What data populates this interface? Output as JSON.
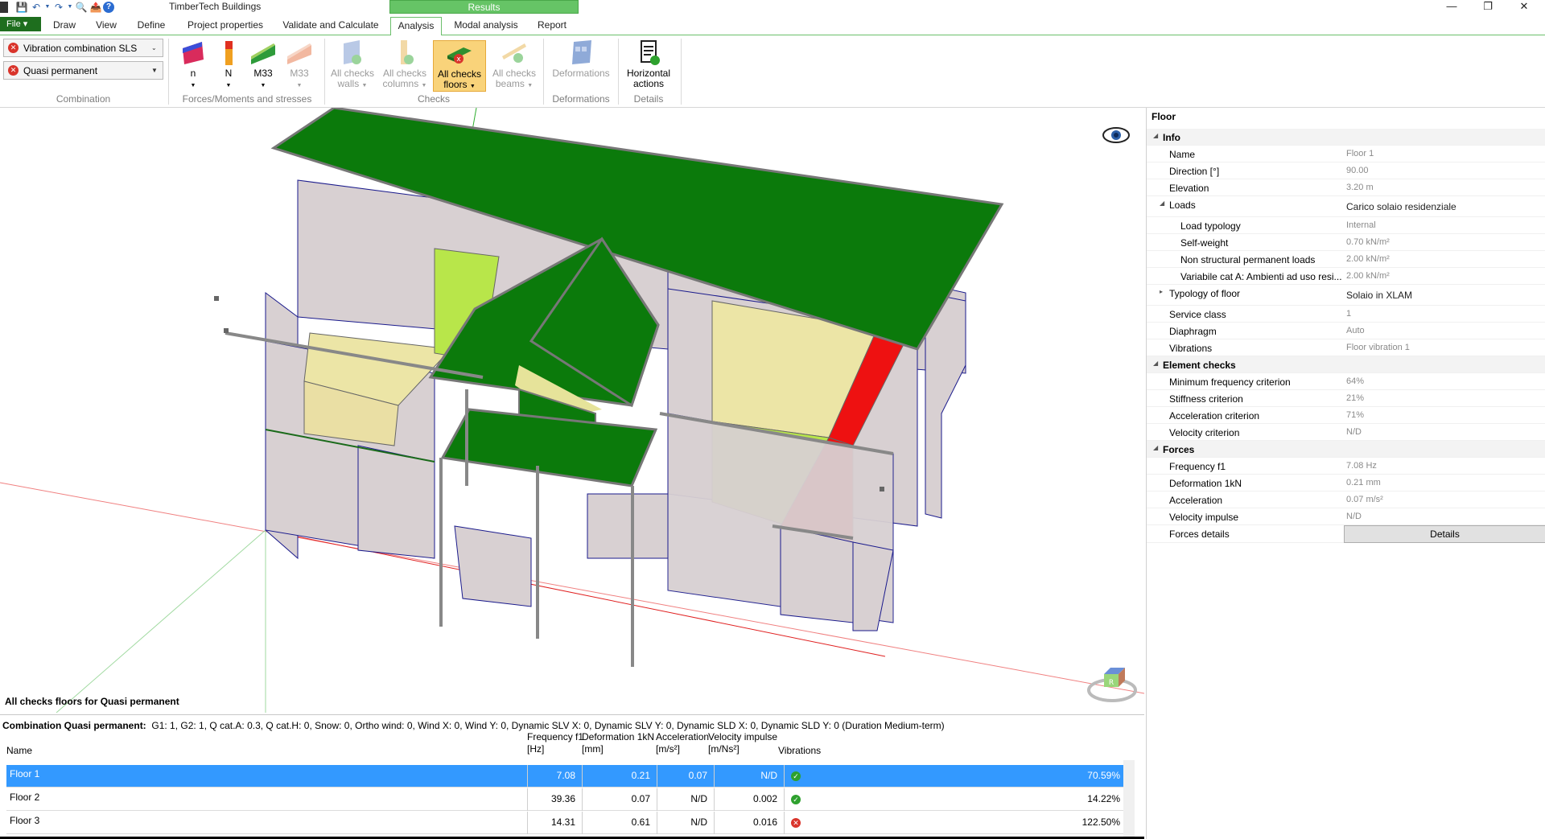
{
  "app": {
    "title": "TimberTech Buildings",
    "context_tab": "Results"
  },
  "tabs": {
    "file": "File",
    "items": [
      "Draw",
      "View",
      "Define",
      "Project properties",
      "Validate and Calculate",
      "Analysis",
      "Modal analysis",
      "Report"
    ],
    "active": "Analysis"
  },
  "ribbon": {
    "combination": {
      "combo1": "Vibration combination SLS",
      "combo2": "Quasi permanent",
      "label": "Combination"
    },
    "forces": {
      "label": "Forces/Moments and stresses",
      "buttons": [
        "n",
        "N",
        "M33",
        "M33"
      ]
    },
    "checks": {
      "label": "Checks",
      "walls": [
        "All checks",
        "walls"
      ],
      "columns": [
        "All checks",
        "columns"
      ],
      "floors": [
        "All checks",
        "floors"
      ],
      "beams": [
        "All checks",
        "beams"
      ]
    },
    "deformations": {
      "label": "Deformations",
      "button": "Deformations"
    },
    "details": {
      "label": "Details",
      "button": [
        "Horizontal",
        "actions"
      ]
    }
  },
  "viewport": {
    "caption": "All checks floors for Quasi permanent"
  },
  "props": {
    "title": "Floor",
    "info": {
      "section": "Info",
      "name_k": "Name",
      "name_v": "Floor 1",
      "dir_k": "Direction [°]",
      "dir_v": "90.00",
      "elev_k": "Elevation",
      "elev_v": "3.20 m",
      "loads_k": "Loads",
      "loads_v": "Carico solaio residenziale",
      "lt_k": "Load typology",
      "lt_v": "Internal",
      "sw_k": "Self-weight",
      "sw_v": "0.70 kN/m²",
      "nsp_k": "Non structural permanent loads",
      "nsp_v": "2.00 kN/m²",
      "var_k": "Variabile cat A: Ambienti ad uso resi...",
      "var_v": "2.00 kN/m²",
      "typ_k": "Typology of floor",
      "typ_v": "Solaio in XLAM",
      "sc_k": "Service class",
      "sc_v": "1",
      "dia_k": "Diaphragm",
      "dia_v": "Auto",
      "vib_k": "Vibrations",
      "vib_v": "Floor vibration 1"
    },
    "checks": {
      "section": "Element checks",
      "mf_k": "Minimum frequency criterion",
      "mf_v": "64%",
      "st_k": "Stiffness criterion",
      "st_v": "21%",
      "ac_k": "Acceleration criterion",
      "ac_v": "71%",
      "ve_k": "Velocity criterion",
      "ve_v": "N/D"
    },
    "forces": {
      "section": "Forces",
      "f1_k": "Frequency f1",
      "f1_v": "7.08 Hz",
      "def_k": "Deformation 1kN",
      "def_v": "0.21 mm",
      "acc_k": "Acceleration",
      "acc_v": "0.07 m/s²",
      "vi_k": "Velocity impulse",
      "vi_v": "N/D",
      "fd_k": "Forces details",
      "fd_btn": "Details"
    }
  },
  "results": {
    "comb_title": "Combination Quasi permanent:",
    "comb_text": "G1: 1, G2: 1, Q cat.A: 0.3, Q cat.H: 0, Snow: 0, Ortho wind: 0, Wind X: 0, Wind Y: 0, Dynamic SLV X: 0, Dynamic SLV Y: 0, Dynamic SLD X: 0, Dynamic SLD Y: 0 (Duration Medium-term)",
    "headers": {
      "name": "Name",
      "f1": "Frequency f1",
      "f1u": "[Hz]",
      "def": "Deformation 1kN",
      "defu": "[mm]",
      "acc": "Acceleration",
      "accu": "[m/s²]",
      "vi": "Velocity impulse",
      "viu": "[m/Ns²]",
      "vib": "Vibrations"
    },
    "rows": [
      {
        "name": "Floor 1",
        "f1": "7.08",
        "def": "0.21",
        "acc": "0.07",
        "vi": "N/D",
        "status": "ok",
        "pct": "70.59%"
      },
      {
        "name": "Floor 2",
        "f1": "39.36",
        "def": "0.07",
        "acc": "N/D",
        "vi": "0.002",
        "status": "ok",
        "pct": "14.22%"
      },
      {
        "name": "Floor 3",
        "f1": "14.31",
        "def": "0.61",
        "acc": "N/D",
        "vi": "0.016",
        "status": "bad",
        "pct": "122.50%"
      }
    ]
  }
}
